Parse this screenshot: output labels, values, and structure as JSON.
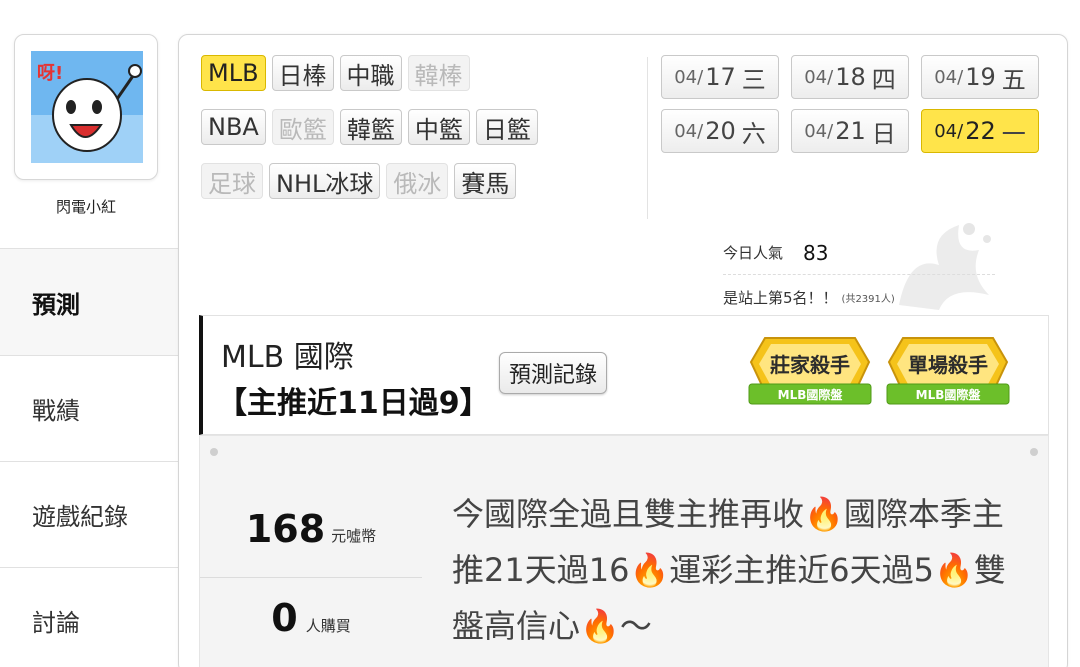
{
  "user": {
    "name": "閃電小紅",
    "avatar_icon": "cartoon-avatar-icon"
  },
  "sidebar": {
    "items": [
      {
        "label": "預測",
        "active": true
      },
      {
        "label": "戰績"
      },
      {
        "label": "遊戲紀錄"
      },
      {
        "label": "討論"
      }
    ]
  },
  "sports": {
    "rows": [
      [
        {
          "label": "MLB",
          "state": "active"
        },
        {
          "label": "日棒"
        },
        {
          "label": "中職"
        },
        {
          "label": "韓棒",
          "state": "disabled"
        }
      ],
      [
        {
          "label": "NBA"
        },
        {
          "label": "歐籃",
          "state": "disabled"
        },
        {
          "label": "韓籃"
        },
        {
          "label": "中籃"
        },
        {
          "label": "日籃"
        }
      ],
      [
        {
          "label": "足球",
          "state": "disabled"
        },
        {
          "label": "NHL冰球"
        },
        {
          "label": "俄冰",
          "state": "disabled"
        },
        {
          "label": "賽馬"
        }
      ]
    ]
  },
  "dates": [
    {
      "md": "04/",
      "d": "17",
      "w": "三"
    },
    {
      "md": "04/",
      "d": "18",
      "w": "四"
    },
    {
      "md": "04/",
      "d": "19",
      "w": "五"
    },
    {
      "md": "04/",
      "d": "20",
      "w": "六"
    },
    {
      "md": "04/",
      "d": "21",
      "w": "日"
    },
    {
      "md": "04/",
      "d": "22",
      "w": "一",
      "active": true
    }
  ],
  "popularity": {
    "label": "今日人氣",
    "count": "83",
    "rank_text": "是站上第5名！！",
    "total_text": "(共2391人)"
  },
  "prediction": {
    "title": "MLB 國際",
    "streak": "【主推近11日過9】",
    "record_button": "預測記錄",
    "badges": [
      {
        "title": "莊家殺手",
        "sub": "MLB國際盤"
      },
      {
        "title": "單場殺手",
        "sub": "MLB國際盤"
      }
    ],
    "price": "168",
    "price_unit": "元噓幣",
    "buyers": "0",
    "buyers_unit": "人購買",
    "description": "今國際全過且雙主推再收🔥國際本季主推21天過16🔥運彩主推近6天過5🔥雙盤高信心🔥～"
  },
  "colors": {
    "accent_yellow": "#ffe44a",
    "badge_green": "#6cbf2a",
    "badge_gold": "#f5c31a"
  }
}
